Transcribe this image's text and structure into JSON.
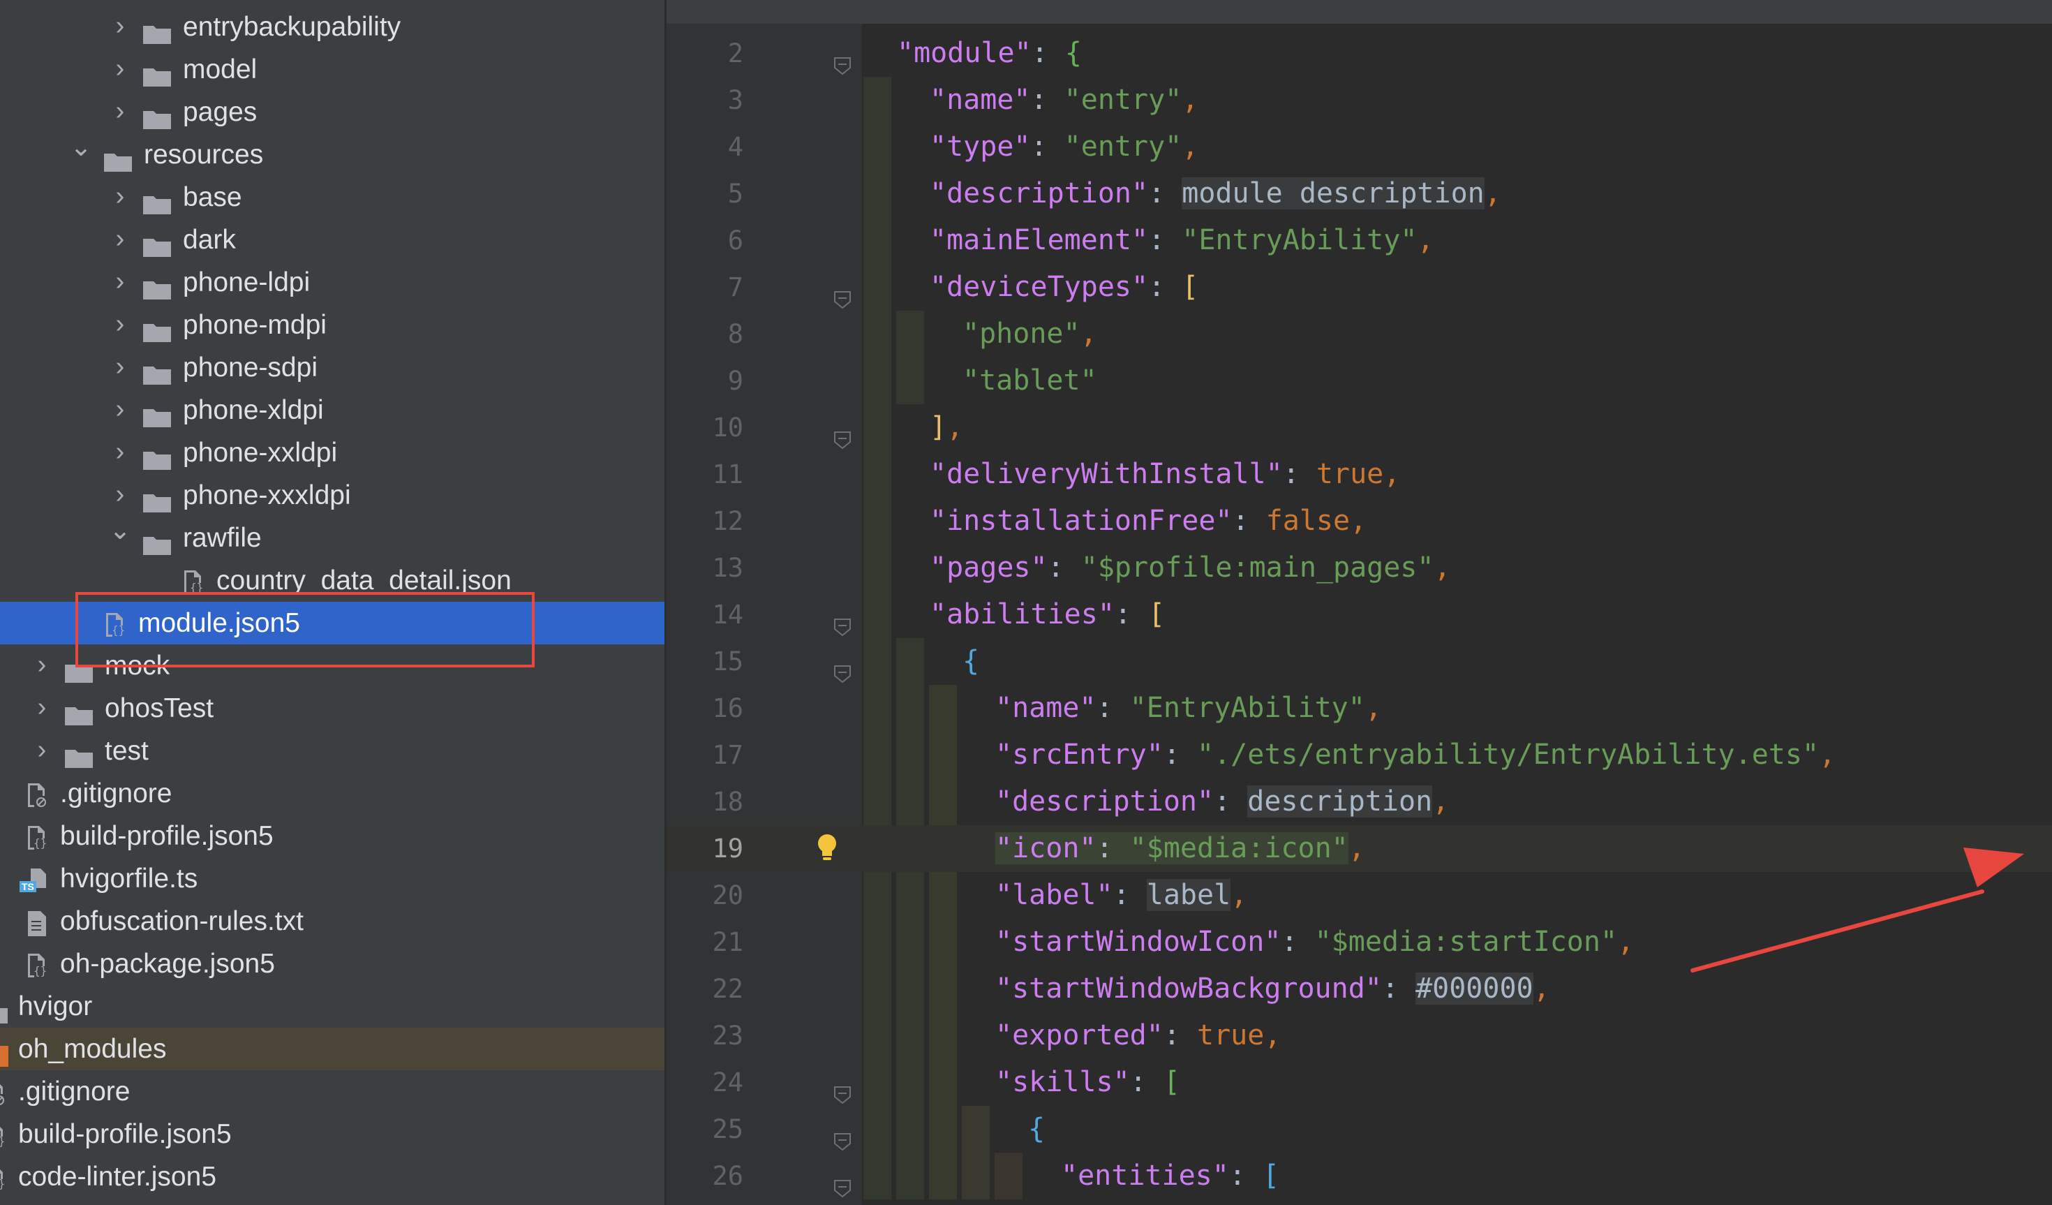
{
  "project_tree": {
    "items": [
      {
        "label": "entrybackupability",
        "type": "folder",
        "depth": 2,
        "expanded": false
      },
      {
        "label": "model",
        "type": "folder",
        "depth": 2,
        "expanded": false
      },
      {
        "label": "pages",
        "type": "folder",
        "depth": 2,
        "expanded": false
      },
      {
        "label": "resources",
        "type": "folder",
        "depth": 1,
        "expanded": true
      },
      {
        "label": "base",
        "type": "folder",
        "depth": 2,
        "expanded": false
      },
      {
        "label": "dark",
        "type": "folder",
        "depth": 2,
        "expanded": false
      },
      {
        "label": "phone-ldpi",
        "type": "folder",
        "depth": 2,
        "expanded": false
      },
      {
        "label": "phone-mdpi",
        "type": "folder",
        "depth": 2,
        "expanded": false
      },
      {
        "label": "phone-sdpi",
        "type": "folder",
        "depth": 2,
        "expanded": false
      },
      {
        "label": "phone-xldpi",
        "type": "folder",
        "depth": 2,
        "expanded": false
      },
      {
        "label": "phone-xxldpi",
        "type": "folder",
        "depth": 2,
        "expanded": false
      },
      {
        "label": "phone-xxxldpi",
        "type": "folder",
        "depth": 2,
        "expanded": false
      },
      {
        "label": "rawfile",
        "type": "folder",
        "depth": 2,
        "expanded": true
      },
      {
        "label": "country_data_detail.json",
        "type": "json-file",
        "depth": 3
      },
      {
        "label": "module.json5",
        "type": "json-file",
        "depth": 1,
        "selected": true
      },
      {
        "label": "mock",
        "type": "folder",
        "depth": 0,
        "expanded": false
      },
      {
        "label": "ohosTest",
        "type": "folder",
        "depth": 0,
        "expanded": false
      },
      {
        "label": "test",
        "type": "folder",
        "depth": 0,
        "expanded": false
      },
      {
        "label": ".gitignore",
        "type": "ignore-file",
        "depth": -1
      },
      {
        "label": "build-profile.json5",
        "type": "json-file",
        "depth": -1
      },
      {
        "label": "hvigorfile.ts",
        "type": "ts-file",
        "depth": -1
      },
      {
        "label": "obfuscation-rules.txt",
        "type": "text-file",
        "depth": -1
      },
      {
        "label": "oh-package.json5",
        "type": "json-file",
        "depth": -1
      },
      {
        "label": "hvigor",
        "type": "folder-cut",
        "depth": -2
      },
      {
        "label": "oh_modules",
        "type": "folder-excluded",
        "depth": -2,
        "excluded": true
      },
      {
        "label": ".gitignore",
        "type": "ignore-file",
        "depth": -2
      },
      {
        "label": "build-profile.json5",
        "type": "json-file",
        "depth": -2
      },
      {
        "label": "code-linter.json5",
        "type": "json-file",
        "depth": -2
      }
    ],
    "ts_badge": "TS"
  },
  "editor": {
    "current_line": 19,
    "lines": [
      {
        "n": 2,
        "indent": 0,
        "fold": true,
        "tokens": [
          [
            "k",
            "\"module\""
          ],
          [
            "plain",
            ": "
          ],
          [
            "b3",
            "{"
          ]
        ]
      },
      {
        "n": 3,
        "indent": 1,
        "tokens": [
          [
            "k",
            "\"name\""
          ],
          [
            "plain",
            ": "
          ],
          [
            "s",
            "\"entry\""
          ],
          [
            "p",
            ","
          ]
        ]
      },
      {
        "n": 4,
        "indent": 1,
        "tokens": [
          [
            "k",
            "\"type\""
          ],
          [
            "plain",
            ": "
          ],
          [
            "s",
            "\"entry\""
          ],
          [
            "p",
            ","
          ]
        ]
      },
      {
        "n": 5,
        "indent": 1,
        "tokens": [
          [
            "k",
            "\"description\""
          ],
          [
            "plain",
            ": "
          ],
          [
            "bare",
            "module description"
          ],
          [
            "p",
            ","
          ]
        ]
      },
      {
        "n": 6,
        "indent": 1,
        "tokens": [
          [
            "k",
            "\"mainElement\""
          ],
          [
            "plain",
            ": "
          ],
          [
            "s",
            "\"EntryAbility\""
          ],
          [
            "p",
            ","
          ]
        ]
      },
      {
        "n": 7,
        "indent": 1,
        "fold": true,
        "tokens": [
          [
            "k",
            "\"deviceTypes\""
          ],
          [
            "plain",
            ": "
          ],
          [
            "b1",
            "["
          ]
        ]
      },
      {
        "n": 8,
        "indent": 2,
        "tokens": [
          [
            "s",
            "\"phone\""
          ],
          [
            "p",
            ","
          ]
        ]
      },
      {
        "n": 9,
        "indent": 2,
        "tokens": [
          [
            "s",
            "\"tablet\""
          ]
        ]
      },
      {
        "n": 10,
        "indent": 1,
        "fold": true,
        "tokens": [
          [
            "b1",
            "]"
          ],
          [
            "p",
            ","
          ]
        ]
      },
      {
        "n": 11,
        "indent": 1,
        "tokens": [
          [
            "k",
            "\"deliveryWithInstall\""
          ],
          [
            "plain",
            ": "
          ],
          [
            "kw",
            "true"
          ],
          [
            "p",
            ","
          ]
        ]
      },
      {
        "n": 12,
        "indent": 1,
        "tokens": [
          [
            "k",
            "\"installationFree\""
          ],
          [
            "plain",
            ": "
          ],
          [
            "kw",
            "false"
          ],
          [
            "p",
            ","
          ]
        ]
      },
      {
        "n": 13,
        "indent": 1,
        "tokens": [
          [
            "k",
            "\"pages\""
          ],
          [
            "plain",
            ": "
          ],
          [
            "s",
            "\"$profile:main_pages\""
          ],
          [
            "p",
            ","
          ]
        ]
      },
      {
        "n": 14,
        "indent": 1,
        "fold": true,
        "tokens": [
          [
            "k",
            "\"abilities\""
          ],
          [
            "plain",
            ": "
          ],
          [
            "b1",
            "["
          ]
        ]
      },
      {
        "n": 15,
        "indent": 2,
        "fold": true,
        "tokens": [
          [
            "b2",
            "{"
          ]
        ]
      },
      {
        "n": 16,
        "indent": 3,
        "tokens": [
          [
            "k",
            "\"name\""
          ],
          [
            "plain",
            ": "
          ],
          [
            "s",
            "\"EntryAbility\""
          ],
          [
            "p",
            ","
          ]
        ]
      },
      {
        "n": 17,
        "indent": 3,
        "tokens": [
          [
            "k",
            "\"srcEntry\""
          ],
          [
            "plain",
            ": "
          ],
          [
            "s",
            "\"./ets/entryability/EntryAbility.ets\""
          ],
          [
            "p",
            ","
          ]
        ]
      },
      {
        "n": 18,
        "indent": 3,
        "tokens": [
          [
            "k",
            "\"description\""
          ],
          [
            "plain",
            ": "
          ],
          [
            "bare",
            "description"
          ],
          [
            "p",
            ","
          ]
        ]
      },
      {
        "n": 19,
        "indent": 3,
        "bulb": true,
        "tokens": [
          [
            "k hl",
            "\"icon\""
          ],
          [
            "plain hl",
            ": "
          ],
          [
            "s hl",
            "\"$media:icon\""
          ],
          [
            "p",
            ","
          ]
        ]
      },
      {
        "n": 20,
        "indent": 3,
        "tokens": [
          [
            "k",
            "\"label\""
          ],
          [
            "plain",
            ": "
          ],
          [
            "bare",
            "label"
          ],
          [
            "p",
            ","
          ]
        ]
      },
      {
        "n": 21,
        "indent": 3,
        "tokens": [
          [
            "k",
            "\"startWindowIcon\""
          ],
          [
            "plain",
            ": "
          ],
          [
            "s",
            "\"$media:startIcon\""
          ],
          [
            "p",
            ","
          ]
        ]
      },
      {
        "n": 22,
        "indent": 3,
        "tokens": [
          [
            "k",
            "\"startWindowBackground\""
          ],
          [
            "plain",
            ": "
          ],
          [
            "bare",
            "#000000"
          ],
          [
            "p",
            ","
          ]
        ]
      },
      {
        "n": 23,
        "indent": 3,
        "tokens": [
          [
            "k",
            "\"exported\""
          ],
          [
            "plain",
            ": "
          ],
          [
            "kw",
            "true"
          ],
          [
            "p",
            ","
          ]
        ]
      },
      {
        "n": 24,
        "indent": 3,
        "fold": true,
        "tokens": [
          [
            "k",
            "\"skills\""
          ],
          [
            "plain",
            ": "
          ],
          [
            "b3",
            "["
          ]
        ]
      },
      {
        "n": 25,
        "indent": 4,
        "fold": true,
        "tokens": [
          [
            "b2",
            "{"
          ]
        ]
      },
      {
        "n": 26,
        "indent": 5,
        "fold": true,
        "tokens": [
          [
            "k",
            "\"entities\""
          ],
          [
            "plain",
            ": "
          ],
          [
            "b2",
            "["
          ]
        ]
      }
    ]
  },
  "colors": {
    "selection": "#2f65ca",
    "annotation_red": "#e8473f",
    "json_key": "#cc7ef0",
    "json_string": "#6a9c59",
    "json_keyword": "#cc7832"
  },
  "icons": {
    "folder": "folder-icon",
    "json_file": "json-file-icon",
    "ts_file": "typescript-file-icon",
    "text_file": "text-file-icon",
    "ignore_file": "gitignore-file-icon",
    "bulb": "intention-bulb-icon",
    "fold": "fold-marker-icon",
    "annotation": "red-arrow-annotation"
  }
}
